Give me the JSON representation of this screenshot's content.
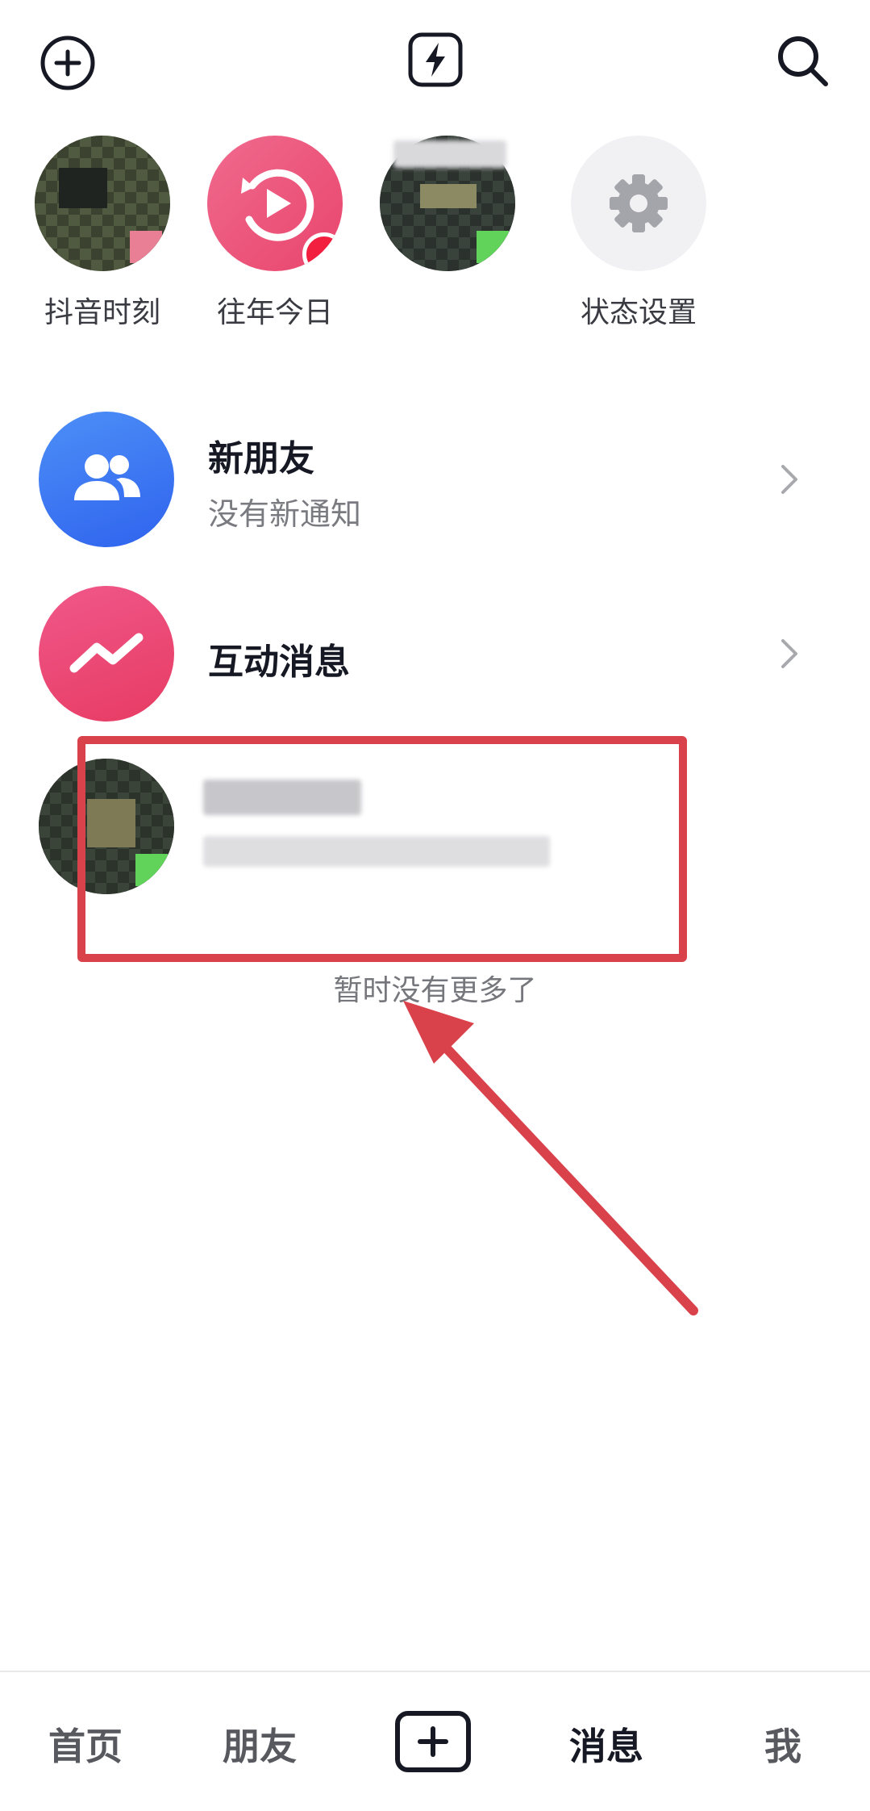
{
  "topbar": {
    "left_icon": "add-circle-icon",
    "center_icon": "lightning-icon",
    "right_icon": "search-icon"
  },
  "stories": [
    {
      "label": "抖音时刻",
      "type": "avatar"
    },
    {
      "label": "往年今日",
      "type": "memory"
    },
    {
      "label": "",
      "type": "avatar"
    },
    {
      "label": "状态设置",
      "type": "settings"
    }
  ],
  "list": {
    "new_friends": {
      "title": "新朋友",
      "subtitle": "没有新通知"
    },
    "interactions": {
      "title": "互动消息"
    }
  },
  "end_text": "暂时没有更多了",
  "colors": {
    "accent_pink": "#ee4a75",
    "accent_blue": "#3b7cf5",
    "annotation_red": "#d9424b",
    "online_green": "#61d35b"
  },
  "nav": {
    "home": "首页",
    "friends": "朋友",
    "messages": "消息",
    "me": "我",
    "publish_icon": "plus-icon"
  }
}
